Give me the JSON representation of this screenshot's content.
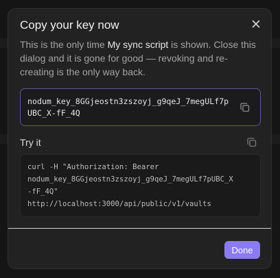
{
  "dialog": {
    "title": "Copy your key now",
    "description_before": "This is the only time ",
    "description_strong": "My sync script",
    "description_after": " is shown. Close this dialog and it is gone for good — revoking and re-creating is the only way back.",
    "key_value": "nodum_key_8GGjeostn3zszoyj_g9qeJ_7megULf7pUBC_X-fF_4Q",
    "try_label": "Try it",
    "code_lines": [
      "curl -H \"Authorization: Bearer",
      "nodum_key_8GGjeostn3zszoyj_g9qeJ_7megULf7pUBC_X",
      "-fF_4Q\"",
      "http://localhost:3000/api/public/v1/vaults"
    ],
    "done_label": "Done"
  },
  "icons": {
    "close": "close-icon",
    "copy_key": "copy-icon",
    "copy_command": "copy-icon"
  },
  "colors": {
    "accent": "#8b7bf0",
    "key_border": "#5f569a",
    "dialog_bg": "#222222"
  }
}
